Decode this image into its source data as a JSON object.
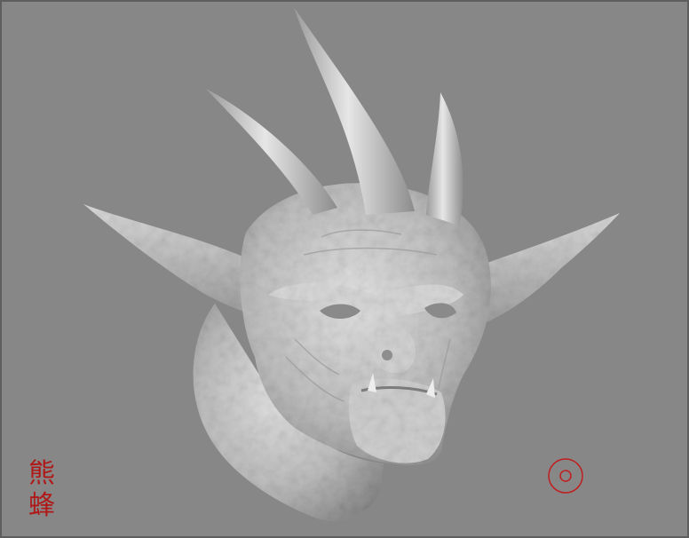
{
  "viewport": {
    "background_color": "#878787",
    "border_color": "#5e5e5e",
    "model_color": "#c9c9c9"
  },
  "signature": {
    "line1": "熊",
    "line2": "蜂",
    "color": "#b01818"
  },
  "icons": {
    "navigation": "target-circle-icon",
    "navigation_color": "#c01e1e"
  }
}
